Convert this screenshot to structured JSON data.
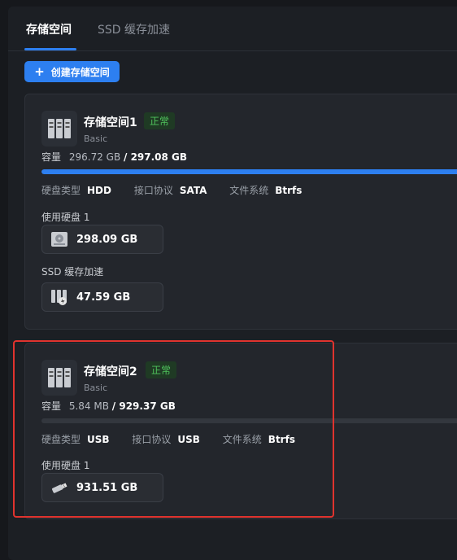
{
  "tabs": [
    {
      "label": "存储空间",
      "active": true
    },
    {
      "label": "SSD 缓存加速",
      "active": false
    }
  ],
  "create_button": {
    "plus": "+",
    "label": "创建存储空间"
  },
  "pools": [
    {
      "name": "存储空间1",
      "status": "正常",
      "type": "Basic",
      "capacity_label": "容量",
      "used": "296.72 GB",
      "total": "/ 297.08 GB",
      "usage_fraction": 0.999,
      "disk_type_label": "硬盘类型",
      "disk_type": "HDD",
      "interface_label": "接口协议",
      "interface": "SATA",
      "fs_label": "文件系统",
      "fs": "Btrfs",
      "disks_label": "使用硬盘 1",
      "disk_size": "298.09 GB",
      "cache_label": "SSD 缓存加速",
      "cache_size": "47.59 GB"
    },
    {
      "name": "存储空间2",
      "status": "正常",
      "type": "Basic",
      "capacity_label": "容量",
      "used": "5.84 MB",
      "total": "/ 929.37 GB",
      "usage_fraction": 1e-05,
      "disk_type_label": "硬盘类型",
      "disk_type": "USB",
      "interface_label": "接口协议",
      "interface": "USB",
      "fs_label": "文件系统",
      "fs": "Btrfs",
      "disks_label": "使用硬盘 1",
      "disk_size": "931.51 GB"
    }
  ],
  "colors": {
    "accent": "#2d7ff0",
    "status_ok": "#4fc35c",
    "highlight": "#e0332e"
  }
}
